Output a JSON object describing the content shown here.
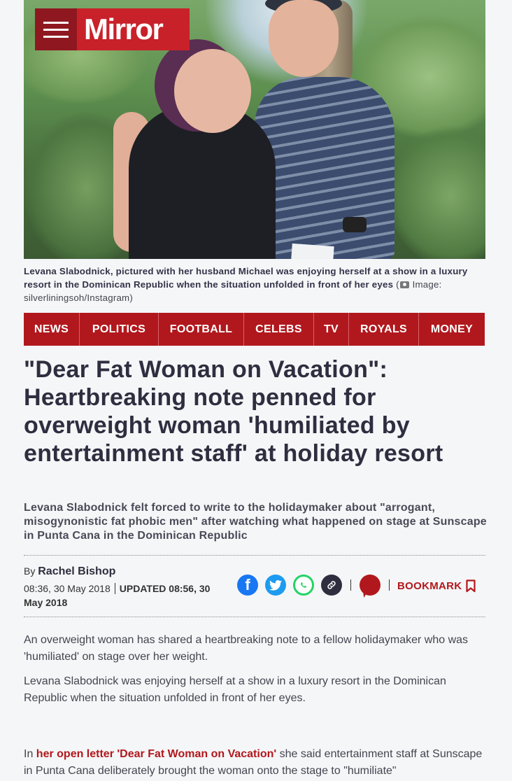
{
  "brand": {
    "name": "Mirror",
    "color": "#c8212a"
  },
  "hero": {
    "caption": "Levana Slabodnick, pictured with her husband Michael was enjoying herself at a show in a luxury resort in the Dominican Republic when the situation unfolded in front of her eyes",
    "credit_open": "(",
    "credit": "Image: silverliningsoh/Instagram)"
  },
  "nav": [
    "NEWS",
    "POLITICS",
    "FOOTBALL",
    "CELEBS",
    "TV",
    "ROYALS",
    "MONEY"
  ],
  "article": {
    "headline": "\"Dear Fat Woman on Vacation\": Heartbreaking note penned for overweight woman 'humiliated by entertainment staff' at holiday resort",
    "standfirst": "Levana Slabodnick felt forced to write to the holidaymaker about \"arrogant, misogynonistic fat phobic men\" after watching what happened on stage at Sunscape in Punta Cana in the Dominican Republic",
    "by_label": "By",
    "author": "Rachel Bishop",
    "published": "08:36, 30 May 2018",
    "updated": "UPDATED 08:56, 30 May 2018",
    "bookmark_label": "BOOKMARK",
    "paragraphs": [
      "An overweight woman has shared a heartbreaking note to a fellow holidaymaker who was 'humiliated' on stage over her weight.",
      "Levana Slabodnick was enjoying herself at a show in a luxury resort in the Dominican Republic when the situation unfolded in front of her eyes."
    ],
    "p3_prefix": "In",
    "p3_link": "her open letter 'Dear Fat Woman on Vacation'",
    "p3_suffix": "she said entertainment staff at Sunscape in Punta Cana deliberately brought the woman onto the stage to \"humiliate\""
  },
  "share_icons": [
    "facebook-icon",
    "twitter-icon",
    "whatsapp-icon",
    "link-icon",
    "comment-icon",
    "bookmark-icon"
  ]
}
